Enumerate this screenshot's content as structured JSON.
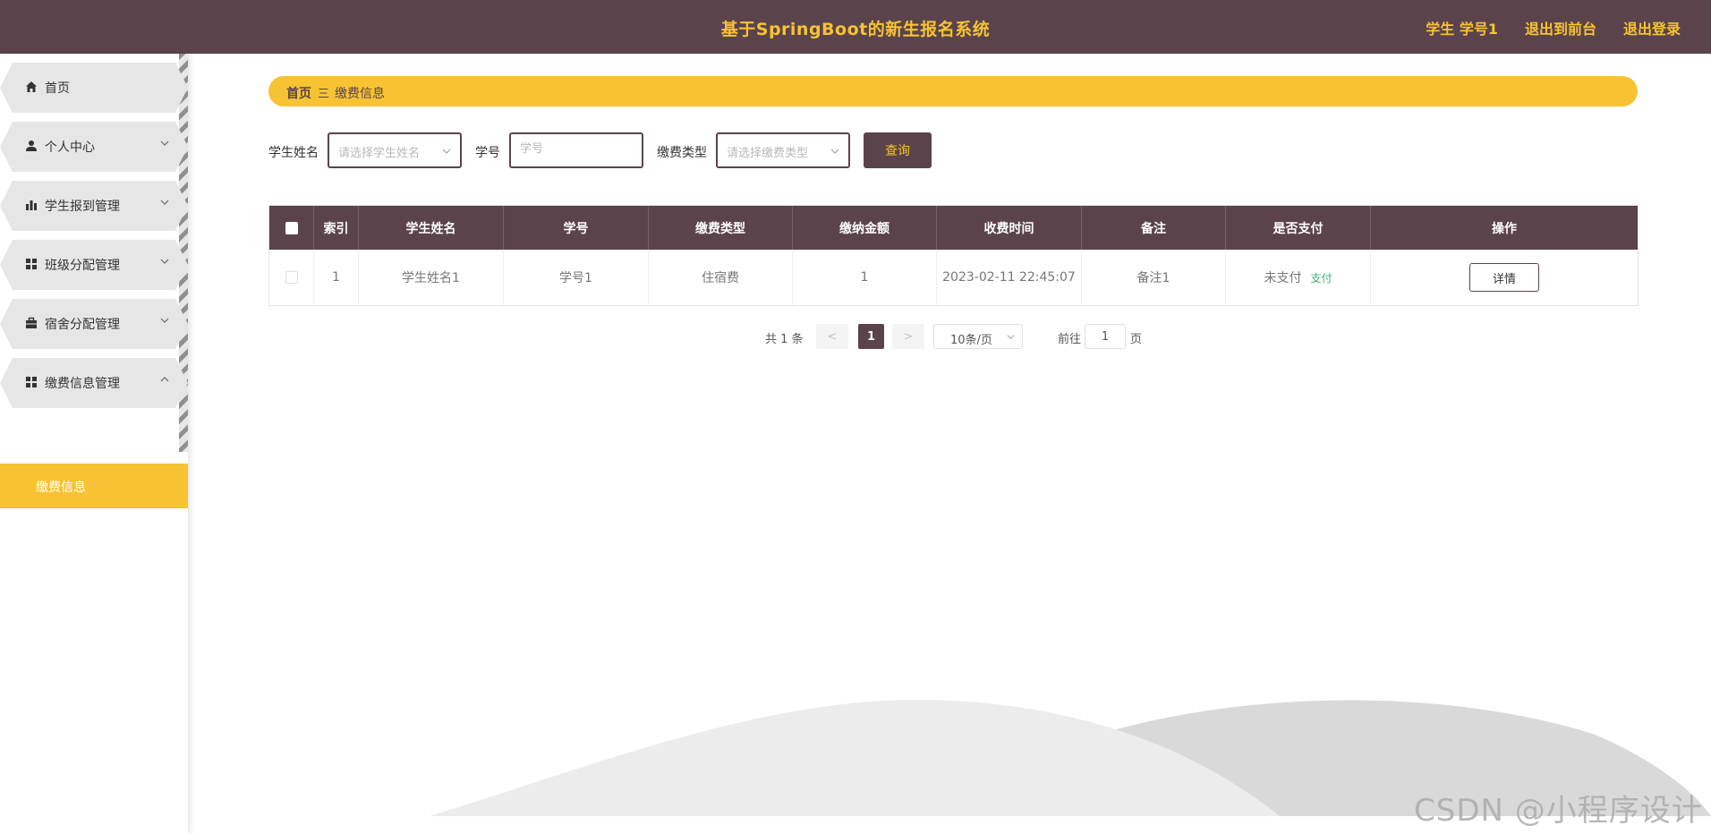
{
  "header": {
    "title": "基于SpringBoot的新生报名系统",
    "user": "学生 学号1",
    "to_front": "退出到前台",
    "logout": "退出登录"
  },
  "sidebar": {
    "items": [
      {
        "label": "首页",
        "icon": "home-icon"
      },
      {
        "label": "个人中心",
        "icon": "user-icon"
      },
      {
        "label": "学生报到管理",
        "icon": "bar-chart-icon"
      },
      {
        "label": "班级分配管理",
        "icon": "grid-icon"
      },
      {
        "label": "宿舍分配管理",
        "icon": "briefcase-icon"
      },
      {
        "label": "缴费信息管理",
        "icon": "grid-icon"
      }
    ],
    "sub_item": "缴费信息"
  },
  "breadcrumb": {
    "home": "首页",
    "separator": "三",
    "current": "缴费信息"
  },
  "search": {
    "student_name_label": "学生姓名",
    "student_name_placeholder": "请选择学生姓名",
    "student_id_label": "学号",
    "student_id_placeholder": "学号",
    "fee_type_label": "缴费类型",
    "fee_type_placeholder": "请选择缴费类型",
    "query_button": "查询"
  },
  "table": {
    "headers": [
      "索引",
      "学生姓名",
      "学号",
      "缴费类型",
      "缴纳金额",
      "收费时间",
      "备注",
      "是否支付",
      "操作"
    ],
    "rows": [
      {
        "index": "1",
        "student_name": "学生姓名1",
        "student_id": "学号1",
        "fee_type": "住宿费",
        "amount": "1",
        "time": "2023-02-11 22:45:07",
        "remark": "备注1",
        "paid_status": "未支付",
        "pay_action": "支付",
        "detail_button": "详情"
      }
    ]
  },
  "pagination": {
    "total": "共 1 条",
    "prev": "<",
    "current_page": "1",
    "next": ">",
    "page_size": "10条/页",
    "goto_label": "前往",
    "goto_value": "1",
    "page_label": "页"
  },
  "watermark": "CSDN @小程序设计",
  "colors": {
    "primary": "#5b434c",
    "accent": "#f7c332",
    "pay_link": "#3fb079"
  }
}
